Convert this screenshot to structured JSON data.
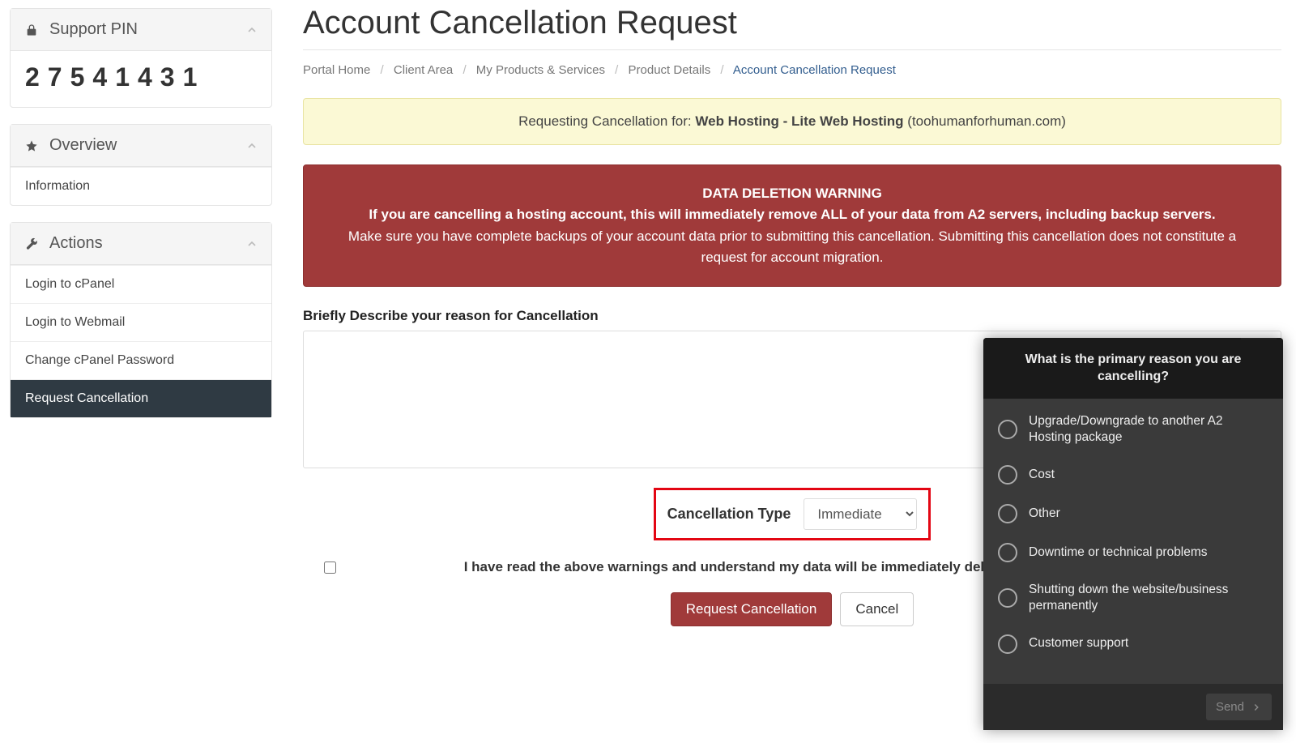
{
  "sidebar": {
    "support_pin": {
      "title": "Support PIN",
      "value": "27541431"
    },
    "overview": {
      "title": "Overview",
      "items": [
        "Information"
      ]
    },
    "actions": {
      "title": "Actions",
      "items": [
        "Login to cPanel",
        "Login to Webmail",
        "Change cPanel Password",
        "Request Cancellation"
      ],
      "active_index": 3
    }
  },
  "page": {
    "title": "Account Cancellation Request",
    "breadcrumb": [
      "Portal Home",
      "Client Area",
      "My Products & Services",
      "Product Details",
      "Account Cancellation Request"
    ]
  },
  "info_alert": {
    "prefix": "Requesting Cancellation for: ",
    "product": "Web Hosting - Lite Web Hosting",
    "suffix": " (toohumanforhuman.com)"
  },
  "warning": {
    "title": "DATA DELETION WARNING",
    "line1": "If you are cancelling a hosting account, this will immediately remove ALL of your data from A2 servers, including backup servers.",
    "line2": "Make sure you have complete backups of your account data prior to submitting this cancellation. Submitting this cancellation does not constitute a request for account migration."
  },
  "form": {
    "reason_label": "Briefly Describe your reason for Cancellation",
    "reason_value": "",
    "type_label": "Cancellation Type",
    "type_value": "Immediate",
    "ack_label": "I have read the above warnings and understand my data will be immediately deleted on cancellation.",
    "submit": "Request Cancellation",
    "cancel": "Cancel"
  },
  "survey": {
    "question": "What is the primary reason you are cancelling?",
    "options": [
      "Upgrade/Downgrade to another A2 Hosting package",
      "Cost",
      "Other",
      "Downtime or technical problems",
      "Shutting down the website/business permanently",
      "Customer support"
    ],
    "send": "Send"
  }
}
